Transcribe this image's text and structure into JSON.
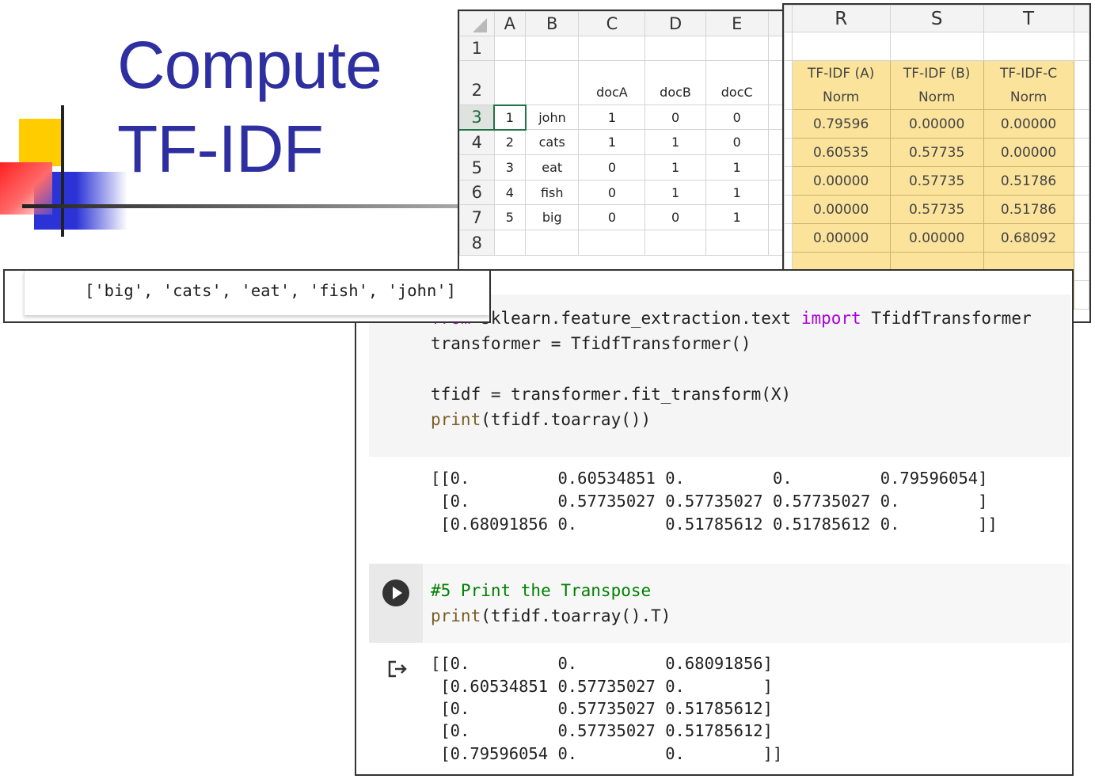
{
  "slide": {
    "title_line1": "Compute",
    "title_line2": "TF-IDF",
    "title_color": "#2e2fa0",
    "decoration_colors": [
      "#ffcc00",
      "#2b33d6",
      "#ff2020"
    ]
  },
  "spreadsheet": {
    "column_headers": [
      "A",
      "B",
      "C",
      "D",
      "E"
    ],
    "row_headers": [
      "1",
      "2",
      "3",
      "4",
      "5",
      "6",
      "7",
      "8"
    ],
    "doc_headers": [
      "docA",
      "docB",
      "docC"
    ],
    "rows": [
      {
        "id": "1",
        "term": "john",
        "values": [
          "1",
          "0",
          "0"
        ]
      },
      {
        "id": "2",
        "term": "cats",
        "values": [
          "1",
          "1",
          "0"
        ]
      },
      {
        "id": "3",
        "term": "eat",
        "values": [
          "0",
          "1",
          "1"
        ]
      },
      {
        "id": "4",
        "term": "fish",
        "values": [
          "0",
          "1",
          "1"
        ]
      },
      {
        "id": "5",
        "term": "big",
        "values": [
          "0",
          "0",
          "1"
        ]
      }
    ]
  },
  "norm_sheet": {
    "column_headers": [
      "R",
      "S",
      "T"
    ],
    "labels": [
      {
        "line1": "TF-IDF (A)",
        "line2": "Norm"
      },
      {
        "line1": "TF-IDF (B)",
        "line2": "Norm"
      },
      {
        "line1": "TF-IDF-C",
        "line2": "Norm"
      }
    ],
    "rows": [
      [
        "0.79596",
        "0.00000",
        "0.00000"
      ],
      [
        "0.60535",
        "0.57735",
        "0.00000"
      ],
      [
        "0.00000",
        "0.57735",
        "0.51786"
      ],
      [
        "0.00000",
        "0.57735",
        "0.51786"
      ],
      [
        "0.00000",
        "0.00000",
        "0.68092"
      ]
    ],
    "highlight_color": "#fbe39b"
  },
  "vocab_output": "['big', 'cats', 'eat', 'fish', 'john']",
  "notebook": {
    "cell1": {
      "line1_kw1": "from",
      "line1_mid": " sklearn.feature_extraction.text ",
      "line1_kw2": "import",
      "line1_end": " TfidfTransformer",
      "line2": "transformer = TfidfTransformer()",
      "line3": "tfidf = transformer.fit_transform(X)",
      "line4_fn": "print",
      "line4_rest": "(tfidf.toarray())"
    },
    "output1": [
      "[[0.         0.60534851 0.         0.         0.79596054]",
      " [0.         0.57735027 0.57735027 0.57735027 0.        ]",
      " [0.68091856 0.         0.51785612 0.51785612 0.        ]]"
    ],
    "cell2": {
      "comment": "#5 Print the Transpose",
      "line2_fn": "print",
      "line2_rest": "(tfidf.toarray().T)"
    },
    "output2": [
      "[[0.         0.         0.68091856]",
      " [0.60534851 0.57735027 0.        ]",
      " [0.         0.57735027 0.51785612]",
      " [0.         0.57735027 0.51785612]",
      " [0.79596054 0.         0.        ]]"
    ],
    "run_icon": "play-circle-icon",
    "output_icon": "output-arrow-icon"
  }
}
